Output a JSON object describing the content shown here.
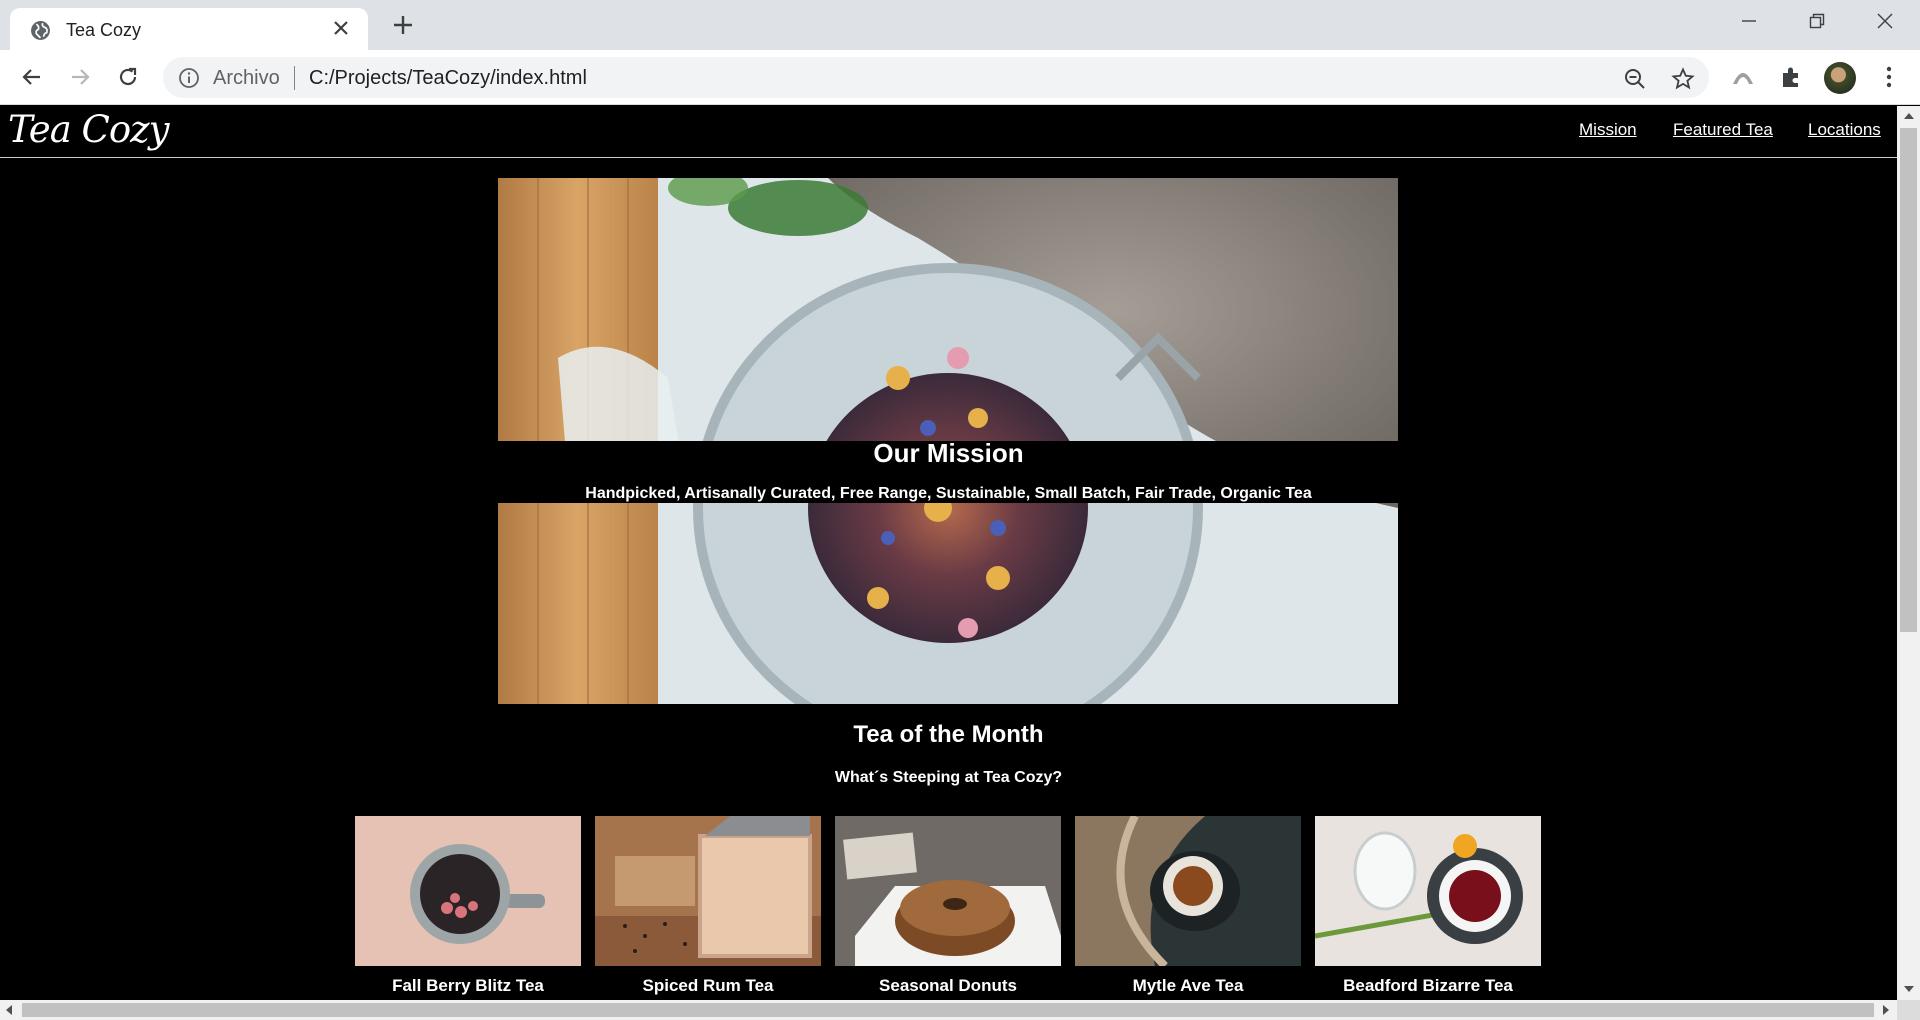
{
  "browser": {
    "tab_title": "Tea Cozy",
    "scheme_label": "Archivo",
    "url": "C:/Projects/TeaCozy/index.html"
  },
  "site": {
    "logo": "Tea Cozy",
    "nav": [
      "Mission",
      "Featured Tea",
      "Locations"
    ]
  },
  "mission": {
    "title": "Our Mission",
    "subtitle": "Handpicked, Artisanally Curated, Free Range, Sustainable, Small Batch, Fair Trade, Organic Tea"
  },
  "tea_of_month": {
    "title": "Tea of the Month",
    "subtitle": "What´s Steeping at Tea Cozy?",
    "items": [
      {
        "name": "Fall Berry Blitz Tea"
      },
      {
        "name": "Spiced Rum Tea"
      },
      {
        "name": "Seasonal Donuts"
      },
      {
        "name": "Mytle Ave Tea"
      },
      {
        "name": "Beadford Bizarre Tea"
      }
    ]
  },
  "colors": {
    "page_bg": "#000000",
    "text": "#ffffff",
    "chrome_bg": "#dee1e6"
  }
}
